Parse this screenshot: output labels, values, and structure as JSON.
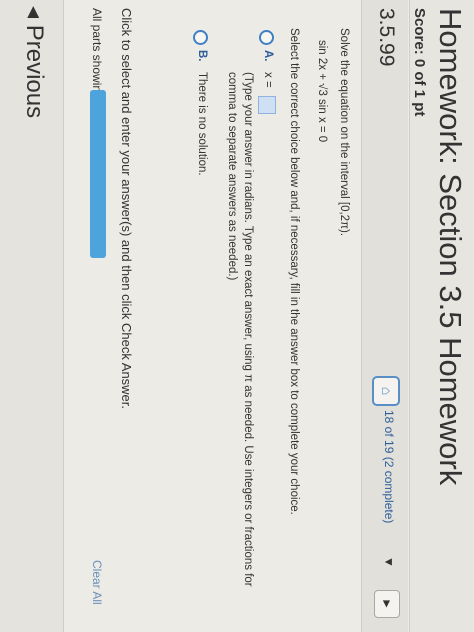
{
  "header": {
    "title": "Homework: Section 3.5 Homework",
    "score": "Score: 0 of 1 pt"
  },
  "problem_bar": {
    "problem_number": "3.5.99",
    "status": "18 of 19 (2 complete)",
    "caret": "▼",
    "next": "►"
  },
  "question": {
    "prompt": "Solve the equation on the interval [0,2π).",
    "equation": "sin 2x + √3 sin x = 0",
    "instruction": "Select the correct choice below and, if necessary, fill in the answer box to complete your choice."
  },
  "choices": {
    "a_letter": "A.",
    "a_prefix": "x =",
    "a_note_1": "(Type your answer in radians. Type an exact answer, using π as needed. Use integers or fractions for",
    "a_note_2": "comma to separate answers as needed.)",
    "b_letter": "B.",
    "b_text": "There is no solution."
  },
  "footer": {
    "click_instruction": "Click to select and enter your answer(s) and then click Check Answer.",
    "all_parts": "All parts showing",
    "clear_all": "Clear All",
    "previous": "◂ Previous"
  },
  "colors": {
    "accent": "#3f7fc4",
    "progress": "#4da3dc"
  }
}
